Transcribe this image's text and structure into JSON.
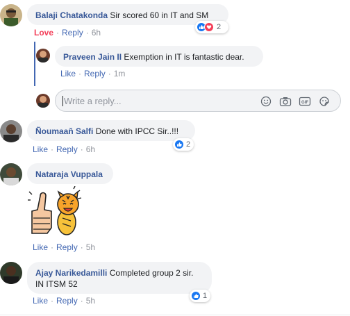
{
  "comments": [
    {
      "author": "Balaji Chatakonda",
      "text": "Sir scored 60 in IT and SM",
      "actions": {
        "reaction_label": "Love",
        "reply": "Reply",
        "time": "6h"
      },
      "reaction_count": "2",
      "reactions": [
        "like",
        "love"
      ]
    },
    {
      "author": "Praveen Jain II",
      "text": "Exemption in IT is fantastic dear.",
      "actions": {
        "like": "Like",
        "reply": "Reply",
        "time": "1m"
      }
    },
    {
      "author": "Ñoumaaň Salfi",
      "text": "Done with IPCC Sir..!!!",
      "actions": {
        "like": "Like",
        "reply": "Reply",
        "time": "6h"
      },
      "reaction_count": "2",
      "reactions": [
        "like"
      ]
    },
    {
      "author": "Nataraja Vuppala",
      "text": "",
      "sticker": "thumbs-up-tiger-sticker",
      "actions": {
        "like": "Like",
        "reply": "Reply",
        "time": "5h"
      }
    },
    {
      "author": "Ajay Narikedamilli",
      "text": "Completed group 2 sir.",
      "text_line2": "IN ITSM 52",
      "actions": {
        "like": "Like",
        "reply": "Reply",
        "time": "5h"
      },
      "reaction_count": "1",
      "reactions": [
        "like"
      ]
    }
  ],
  "reply_box": {
    "placeholder": "Write a reply...",
    "icons": [
      "emoji-icon",
      "camera-icon",
      "gif-icon",
      "sticker-icon"
    ]
  },
  "colors": {
    "name_link": "#385898",
    "action_link": "#4267b2",
    "love": "#f33e58",
    "like_blue": "#1877f2",
    "bubble_bg": "#f2f3f5"
  }
}
